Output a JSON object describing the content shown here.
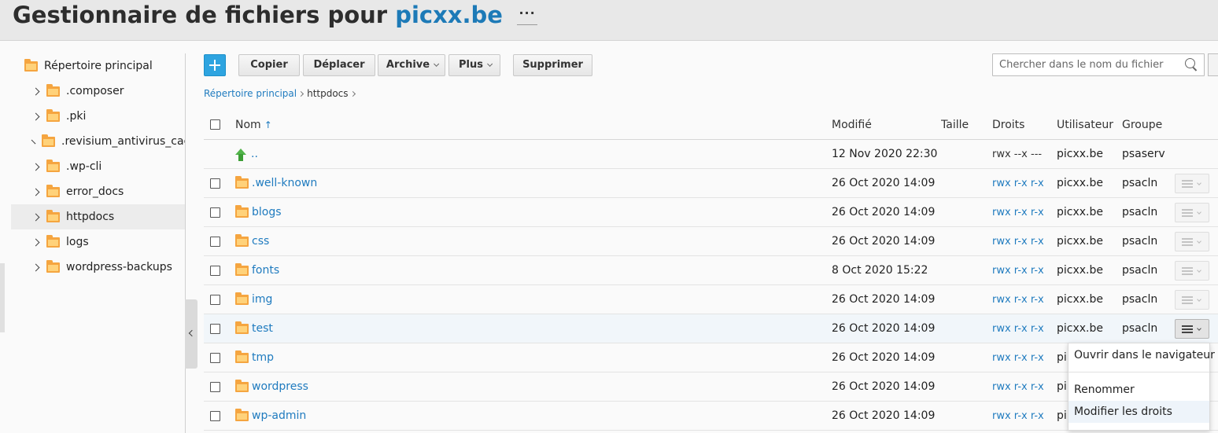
{
  "header": {
    "title_prefix": "Gestionnaire de fichiers pour",
    "title_domain": "picxx.be",
    "more_label": "···"
  },
  "sidebar": {
    "root": "Répertoire principal",
    "items": [
      {
        "label": ".composer",
        "selected": false
      },
      {
        "label": ".pki",
        "selected": false
      },
      {
        "label": ".revisium_antivirus_cache",
        "selected": false
      },
      {
        "label": ".wp-cli",
        "selected": false
      },
      {
        "label": "error_docs",
        "selected": false
      },
      {
        "label": "httpdocs",
        "selected": true
      },
      {
        "label": "logs",
        "selected": false
      },
      {
        "label": "wordpress-backups",
        "selected": false
      }
    ]
  },
  "toolbar": {
    "copy": "Copier",
    "move": "Déplacer",
    "archive": "Archive",
    "more": "Plus",
    "delete": "Supprimer",
    "search_placeholder": "Chercher dans le nom du fichier"
  },
  "breadcrumb": {
    "root": "Répertoire principal",
    "current": "httpdocs"
  },
  "table": {
    "headers": {
      "name": "Nom",
      "sort_indicator": "↑",
      "modified": "Modifié",
      "size": "Taille",
      "rights": "Droits",
      "user": "Utilisateur",
      "group": "Groupe"
    },
    "parent_row": {
      "name": "..",
      "modified": "12 Nov 2020 22:30",
      "rights": "rwx --x ---",
      "user": "picxx.be",
      "group": "psaserv"
    },
    "rows": [
      {
        "name": ".well-known",
        "modified": "26 Oct 2020 14:09",
        "rights": "rwx r-x r-x",
        "user": "picxx.be",
        "group": "psacln"
      },
      {
        "name": "blogs",
        "modified": "26 Oct 2020 14:09",
        "rights": "rwx r-x r-x",
        "user": "picxx.be",
        "group": "psacln"
      },
      {
        "name": "css",
        "modified": "26 Oct 2020 14:09",
        "rights": "rwx r-x r-x",
        "user": "picxx.be",
        "group": "psacln"
      },
      {
        "name": "fonts",
        "modified": "8 Oct 2020 15:22",
        "rights": "rwx r-x r-x",
        "user": "picxx.be",
        "group": "psacln"
      },
      {
        "name": "img",
        "modified": "26 Oct 2020 14:09",
        "rights": "rwx r-x r-x",
        "user": "picxx.be",
        "group": "psacln"
      },
      {
        "name": "test",
        "modified": "26 Oct 2020 14:09",
        "rights": "rwx r-x r-x",
        "user": "picxx.be",
        "group": "psacln"
      },
      {
        "name": "tmp",
        "modified": "26 Oct 2020 14:09",
        "rights": "rwx r-x r-x",
        "user": "pi",
        "group": ""
      },
      {
        "name": "wordpress",
        "modified": "26 Oct 2020 14:09",
        "rights": "rwx r-x r-x",
        "user": "pi",
        "group": ""
      },
      {
        "name": "wp-admin",
        "modified": "26 Oct 2020 14:09",
        "rights": "rwx r-x r-x",
        "user": "pi",
        "group": ""
      }
    ],
    "active_menu_row": "test"
  },
  "context_menu": {
    "items": [
      {
        "label": "Ouvrir dans le navigateur",
        "highlight": false
      },
      {
        "label": "Renommer",
        "highlight": false
      },
      {
        "label": "Modifier les droits",
        "highlight": true
      }
    ]
  },
  "colors": {
    "accent": "#1f7bbf",
    "add_button": "#2ea4e0",
    "folder": "#f5a540",
    "up_arrow": "#52b34a"
  }
}
